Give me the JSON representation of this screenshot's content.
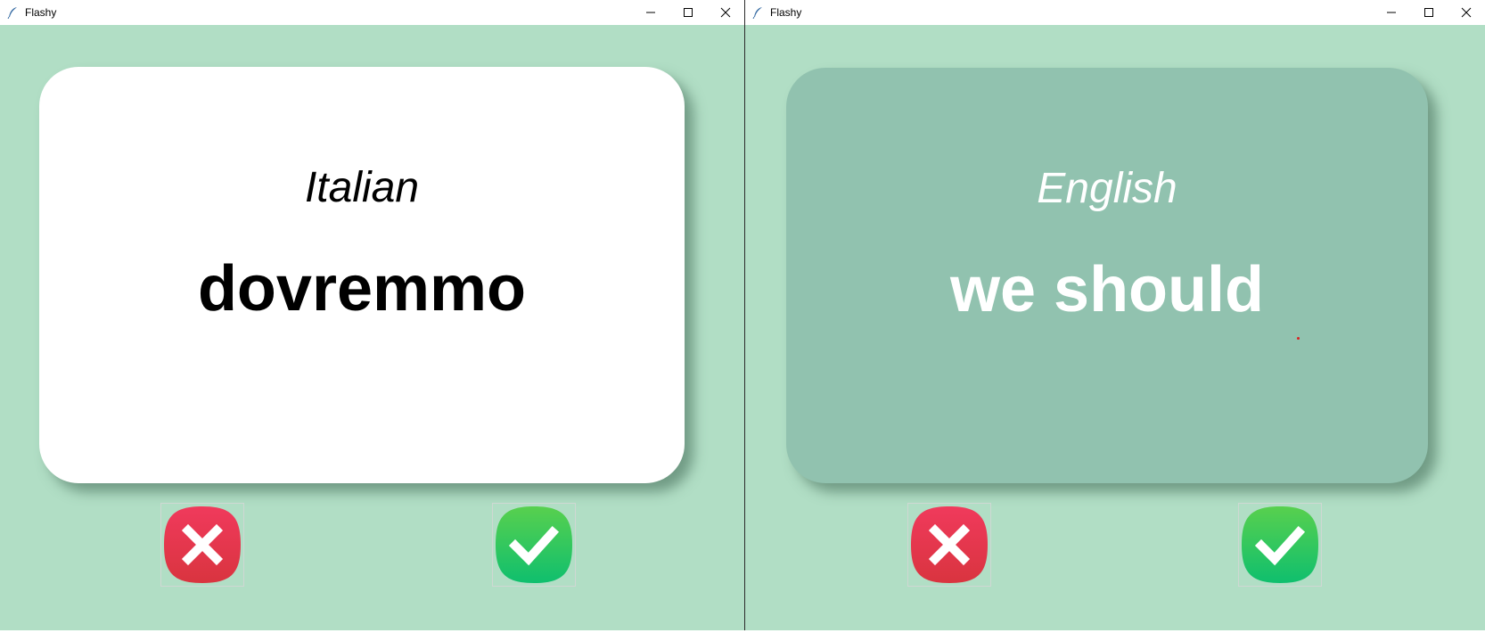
{
  "windows": [
    {
      "title": "Flashy",
      "card": {
        "language": "Italian",
        "word": "dovremmo",
        "side": "front",
        "color": "#ffffff"
      },
      "buttons": {
        "wrong": "cross-icon",
        "right": "check-icon"
      }
    },
    {
      "title": "Flashy",
      "card": {
        "language": "English",
        "word": "we should",
        "side": "back",
        "color": "#91c2af"
      },
      "buttons": {
        "wrong": "cross-icon",
        "right": "check-icon"
      }
    }
  ],
  "colors": {
    "background": "#b1dec5",
    "wrong_button": "#e0304e",
    "right_button": "#17c26a"
  }
}
